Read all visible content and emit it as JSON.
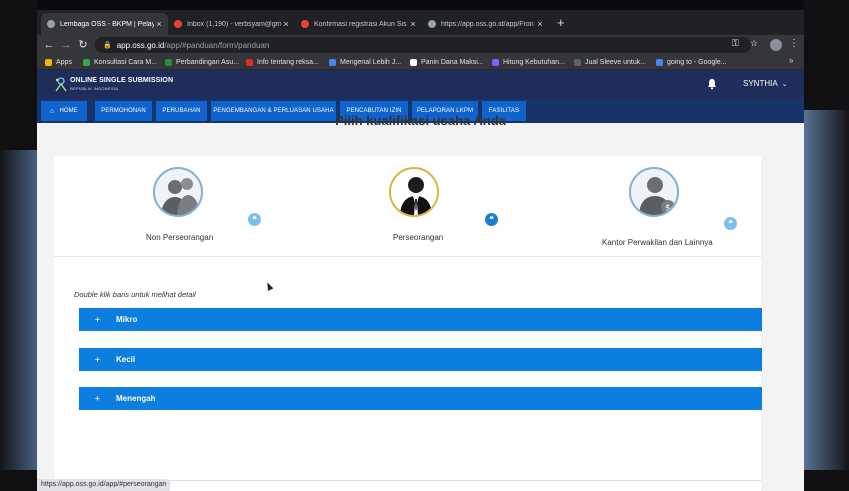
{
  "browser": {
    "tabs": [
      {
        "title": "Lembaga OSS - BKPM | Pelay",
        "favicon_color": "#9aa0a6",
        "active": true
      },
      {
        "title": "Inbox (1,190) - verbsyam@gm",
        "favicon_color": "#ea4335",
        "active": false
      },
      {
        "title": "Konfirmasi registrasi Akun Sis",
        "favicon_color": "#ea4335",
        "active": false
      },
      {
        "title": "https://app.oss.go.id/app/Fron",
        "favicon_color": "#9aa0a6",
        "active": false
      }
    ],
    "close_glyph": "×",
    "new_tab_glyph": "+",
    "url_domain": "app.oss.go.id",
    "url_path": "/app/#panduan/form/panduan",
    "bookmarks": [
      {
        "label": "Apps",
        "color": "#f4b400"
      },
      {
        "label": "Konsultasi Cara M...",
        "color": "#34a853"
      },
      {
        "label": "Perbandingan Asu...",
        "color": "#1e8e3e"
      },
      {
        "label": "Info tentang reksa...",
        "color": "#d93025"
      },
      {
        "label": "Mengenal Lebih J...",
        "color": "#4285f4"
      },
      {
        "label": "Panin Dana Maksi...",
        "color": "#ffffff"
      },
      {
        "label": "Hitung Kebutuhan...",
        "color": "#7b61ff"
      },
      {
        "label": "Jual Sleeve untuk...",
        "color": "#5f6368"
      },
      {
        "label": "going to - Google...",
        "color": "#4285f4"
      }
    ],
    "more_glyph": "»",
    "status_url": "https://app.oss.go.id/app/#perseorangan"
  },
  "site": {
    "logo_title": "ONLINE SINGLE SUBMISSION",
    "logo_subtitle": "REPUBLIK INDONESIA",
    "user_name": "SYNTHIA",
    "nav": [
      "HOME",
      "PERMOHONAN",
      "PERUBAHAN",
      "PENGEMBANGAN & PERLUASAN USAHA",
      "PENCABUTAN IZIN",
      "PELAPORAN LKPM",
      "FASILITAS"
    ],
    "colors": {
      "header": "#1f2d5a",
      "nav_bar": "#17346a",
      "nav_button": "#0e63cc",
      "accordion": "#0b7ee0"
    }
  },
  "main": {
    "heading": "Pilih kualifikasi usaha Anda",
    "options": [
      {
        "label": "Non Perseorangan",
        "selected": false
      },
      {
        "label": "Perseorangan",
        "selected": true
      },
      {
        "label": "Kantor Perwakilan dan Lainnya",
        "selected": false
      }
    ],
    "quote_glyph": "❝",
    "hint": "Double klik baris untuk melihat detail",
    "accordion": [
      {
        "label": "Mikro",
        "icon": "+"
      },
      {
        "label": "Kecil",
        "icon": "+"
      },
      {
        "label": "Menengah",
        "icon": "+"
      }
    ]
  }
}
